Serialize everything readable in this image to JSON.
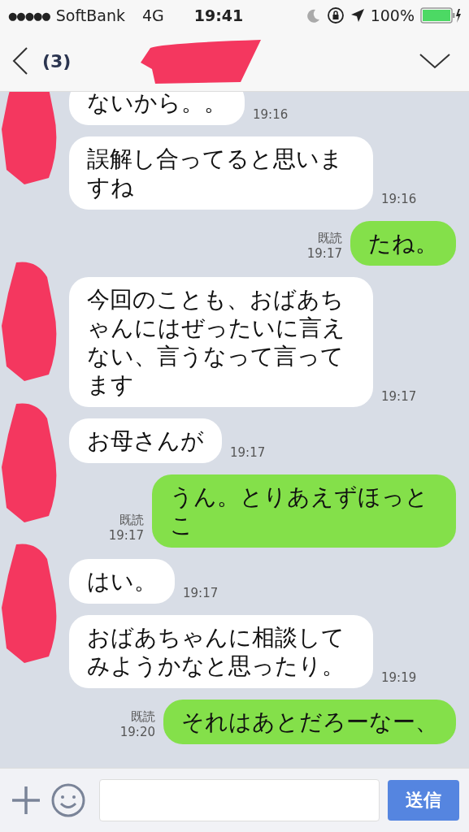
{
  "status_bar": {
    "signal_dots": "●●●●●",
    "carrier": "SoftBank",
    "network": "4G",
    "time": "19:41",
    "battery": "100%"
  },
  "header": {
    "unread": "(3)",
    "title_redacted": true
  },
  "messages": [
    {
      "kind": "in",
      "text": "ないから。。",
      "time": "19:16",
      "redacted_avatar": true
    },
    {
      "kind": "in",
      "text": "誤解し合ってると思いますね",
      "time": "19:16",
      "redacted_avatar": false
    },
    {
      "kind": "out",
      "text": "たね。",
      "time": "19:17",
      "read": "既読"
    },
    {
      "kind": "in",
      "text": "今回のことも、おばあちゃんにはぜったいに言えない、言うなって言ってます",
      "time": "19:17",
      "redacted_avatar": true
    },
    {
      "kind": "in",
      "text": "お母さんが",
      "time": "19:17",
      "redacted_avatar": true
    },
    {
      "kind": "out",
      "text": "うん。とりあえずほっとこ",
      "time": "19:17",
      "read": "既読"
    },
    {
      "kind": "in",
      "text": "はい。",
      "time": "19:17",
      "redacted_avatar": true
    },
    {
      "kind": "in",
      "text": "おばあちゃんに相談してみようかなと思ったり。",
      "time": "19:19",
      "redacted_avatar": false
    },
    {
      "kind": "out",
      "text": "それはあとだろーなー、",
      "time": "19:20",
      "read": "既読"
    }
  ],
  "input_bar": {
    "send_label": "送信"
  }
}
